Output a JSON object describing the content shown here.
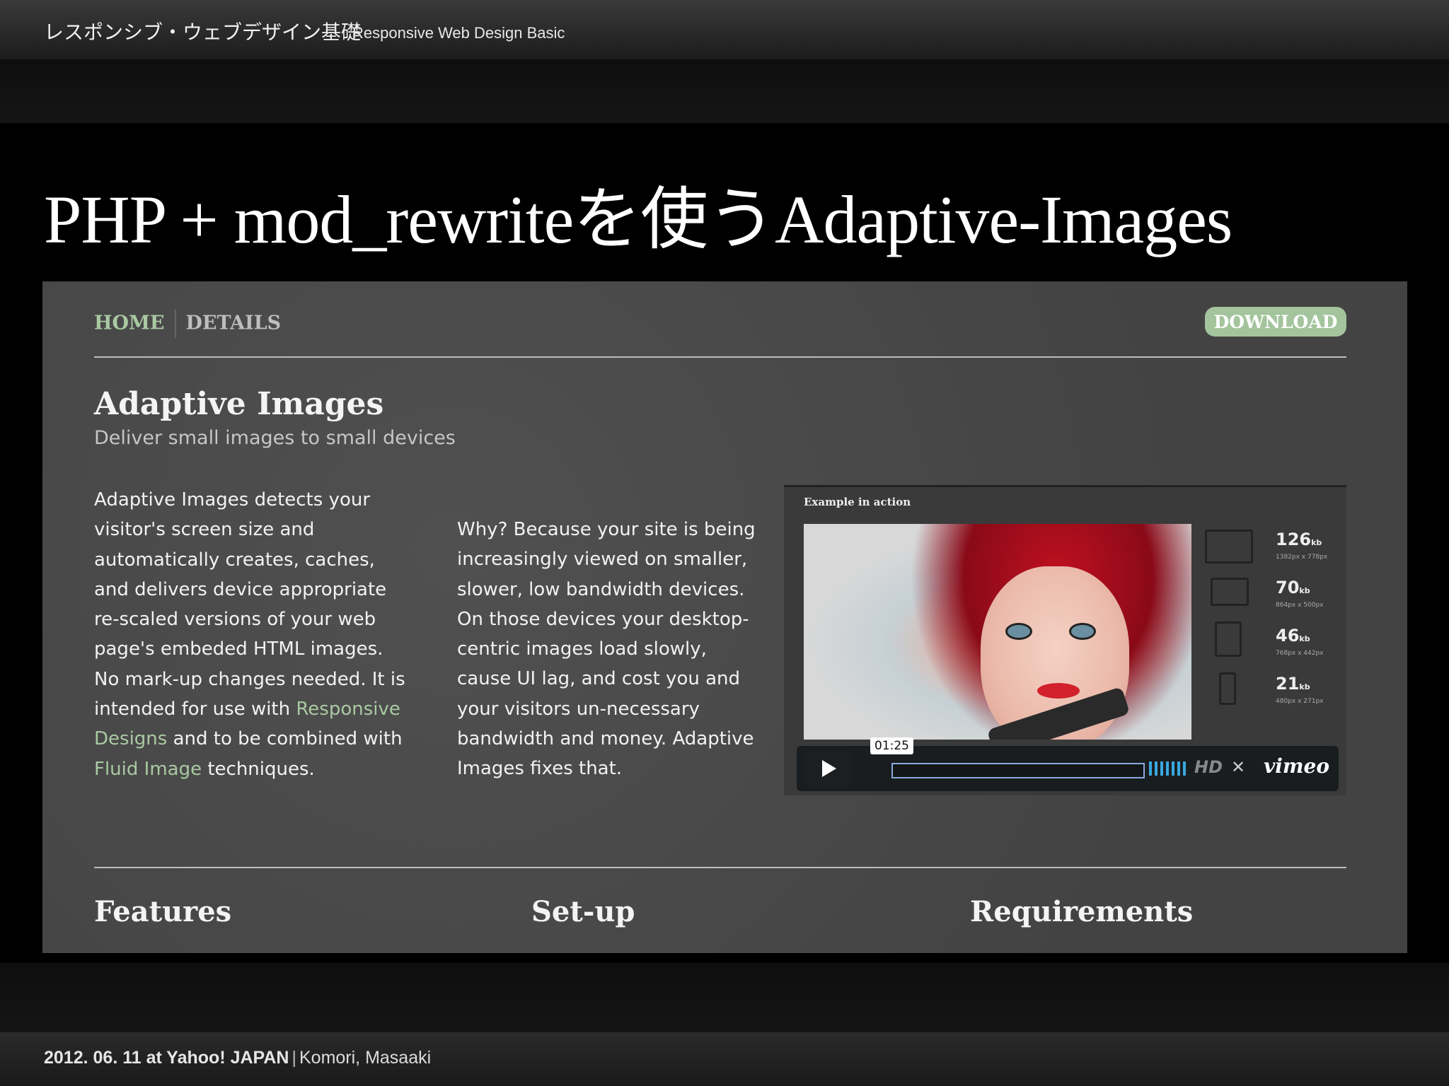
{
  "header": {
    "title_jp": "レスポンシブ・ウェブデザイン基礎",
    "title_en": "Responsive Web Design Basic"
  },
  "slide": {
    "title": "PHP + mod_rewriteを使うAdaptive-Images"
  },
  "site": {
    "nav": {
      "home": "HOME",
      "details": "DETAILS"
    },
    "download_label": "DOWNLOAD",
    "title": "Adaptive Images",
    "subtitle": "Deliver small images to small devices",
    "col1": {
      "text_a": "Adaptive Images detects your visitor's screen size and automatically creates, caches, and delivers device appropriate re-scaled versions of your web page's embeded HTML images. No mark-up changes needed. It is intended for use with ",
      "link1": "Responsive Designs",
      "text_b": " and to be combined with ",
      "link2": "Fluid Image",
      "text_c": " techniques."
    },
    "col2": "Why? Because your site is being increasingly viewed on smaller, slower, low bandwidth devices. On those devices your desktop-centric images load slowly, cause UI lag, and cost you and your visitors un-necessary bandwidth and money. Adaptive Images fixes that.",
    "video": {
      "label": "Example in action",
      "time": "01:25",
      "hd": "HD",
      "brand": "vimeo",
      "devices": [
        {
          "value": "126",
          "unit": "kb",
          "res": "1382px x 778px"
        },
        {
          "value": "70",
          "unit": "kb",
          "res": "864px x 500px"
        },
        {
          "value": "46",
          "unit": "kb",
          "res": "768px x 442px"
        },
        {
          "value": "21",
          "unit": "kb",
          "res": "480px x 271px"
        }
      ]
    },
    "sections": [
      "Features",
      "Set-up",
      "Requirements"
    ]
  },
  "footer": {
    "date": "2012. 06. 11 at Yahoo! JAPAN",
    "separator": "|",
    "author": "Komori, Masaaki"
  }
}
